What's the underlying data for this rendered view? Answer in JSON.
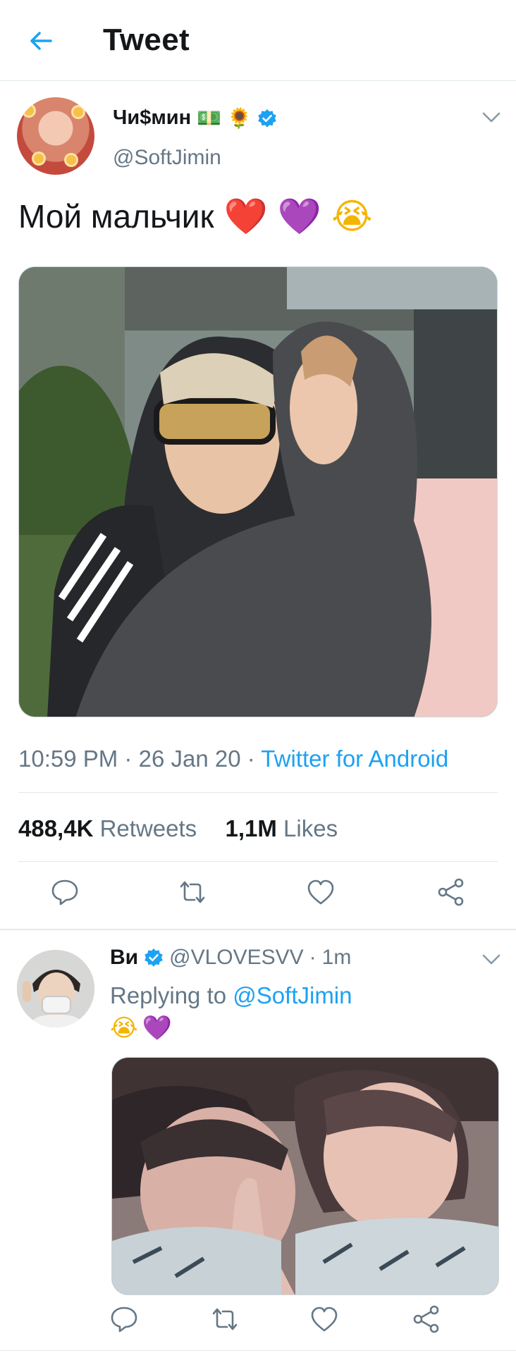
{
  "topbar": {
    "title": "Tweet",
    "back_icon": "arrow-left-icon"
  },
  "tweet": {
    "author": {
      "display_name": "Чи$мин",
      "name_emojis": [
        "💵",
        "🌻"
      ],
      "verified": true,
      "handle": "@SoftJimin"
    },
    "text": "Мой мальчик",
    "text_emojis": [
      "❤️",
      "💜",
      "😭"
    ],
    "time": "10:59 PM",
    "date": "26 Jan 20",
    "source": "Twitter for Android",
    "retweets_count": "488,4K",
    "retweets_label": "Retweets",
    "likes_count": "1,1M",
    "likes_label": "Likes",
    "actions": [
      "reply-icon",
      "retweet-icon",
      "like-icon",
      "share-icon"
    ]
  },
  "reply": {
    "author": {
      "display_name": "Ви",
      "verified": true,
      "handle": "@VLOVESVV",
      "time": "1m"
    },
    "replying_to_label": "Replying to",
    "replying_to_handle": "@SoftJimin",
    "text_emojis": [
      "😭",
      "💜"
    ],
    "actions": [
      "reply-icon",
      "retweet-icon",
      "like-icon",
      "share-icon"
    ]
  },
  "colors": {
    "accent": "#1da1f2",
    "text": "#14171a",
    "secondary": "#657786",
    "divider": "#e1e8ed"
  }
}
